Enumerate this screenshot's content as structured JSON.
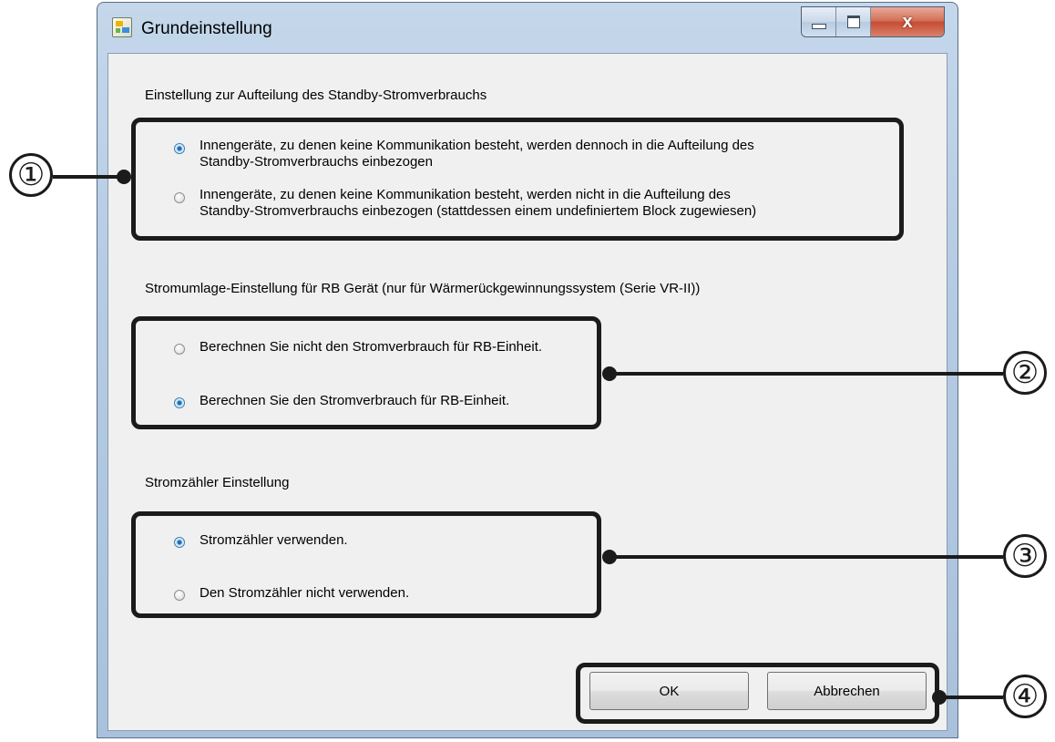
{
  "window": {
    "title": "Grundeinstellung",
    "app_icon": "app-icon",
    "controls": {
      "minimize": "minimize-icon",
      "maximize": "maximize-icon",
      "close": "close-icon",
      "close_glyph": "x"
    }
  },
  "standby": {
    "heading": "Einstellung zur Aufteilung des Standby-Stromverbrauchs",
    "options": [
      {
        "line1": "Innengeräte, zu denen keine Kommunikation besteht, werden dennoch in die Aufteilung des",
        "line2": "Standby-Stromverbrauchs einbezogen",
        "checked": true
      },
      {
        "line1": "Innengeräte, zu denen keine Kommunikation besteht, werden nicht  in die Aufteilung des",
        "line2": "Standby-Stromverbrauchs einbezogen (stattdessen einem undefiniertem Block zugewiesen)",
        "checked": false
      }
    ]
  },
  "rb": {
    "heading": "Stromumlage-Einstellung für RB Gerät (nur für Wärmerückgewinnungssystem (Serie VR-II))",
    "options": [
      {
        "label": "Berechnen Sie nicht den Stromverbrauch für RB-Einheit.",
        "checked": false
      },
      {
        "label": "Berechnen Sie den Stromverbrauch für RB-Einheit.",
        "checked": true
      }
    ]
  },
  "meter": {
    "heading": "Stromzähler Einstellung",
    "options": [
      {
        "label": "Stromzähler verwenden.",
        "checked": true
      },
      {
        "label": "Den Stromzähler nicht verwenden.",
        "checked": false
      }
    ]
  },
  "buttons": {
    "ok": "OK",
    "cancel": "Abbrechen"
  },
  "annotations": {
    "c1": "①",
    "c2": "②",
    "c3": "③",
    "c4": "④"
  },
  "colors": {
    "annotation": "#1b1b1b",
    "radio_selected": "#2f81c6",
    "frame": "#b5cbe3",
    "close_button": "#c74d32"
  }
}
